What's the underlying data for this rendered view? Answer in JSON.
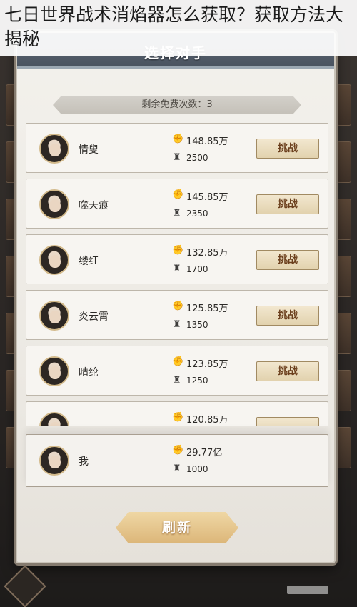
{
  "headline": "七日世界战术消焰器怎么获取？获取方法大揭秘",
  "panel": {
    "title": "选择对手",
    "free_times": "剩余免费次数：3"
  },
  "opponents": [
    {
      "name": "情叟",
      "power": "148.85万",
      "level": "2500",
      "action": "挑战"
    },
    {
      "name": "噬天痕",
      "power": "145.85万",
      "level": "2350",
      "action": "挑战"
    },
    {
      "name": "缕红",
      "power": "132.85万",
      "level": "1700",
      "action": "挑战"
    },
    {
      "name": "炎云霄",
      "power": "125.85万",
      "level": "1350",
      "action": "挑战"
    },
    {
      "name": "晴纶",
      "power": "123.85万",
      "level": "1250",
      "action": "挑战"
    },
    {
      "name": "",
      "power": "120.85万",
      "level": "",
      "action": ""
    }
  ],
  "me": {
    "name": "我",
    "power": "29.77亿",
    "level": "1000"
  },
  "refresh_label": "刷新",
  "icons": {
    "power": "fist-power-icon",
    "level": "rank-crest-icon"
  }
}
